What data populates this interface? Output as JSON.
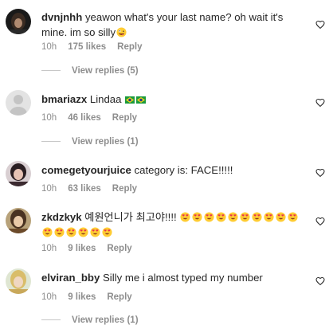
{
  "comments": [
    {
      "username": "dvnjnhh",
      "text": "yeawon what's your last name? oh wait it's mine. im so silly",
      "emoji": "zany-face",
      "time": "10h",
      "likes": "175 likes",
      "reply": "Reply",
      "view_replies": "View replies (5)"
    },
    {
      "username": "bmariazx",
      "text": "Lindaa",
      "emoji": "brazil-flags",
      "time": "10h",
      "likes": "46 likes",
      "reply": "Reply",
      "view_replies": "View replies (1)"
    },
    {
      "username": "comegetyourjuice",
      "text": "category is: FACE!!!!!",
      "time": "10h",
      "likes": "63 likes",
      "reply": "Reply"
    },
    {
      "username": "zkdzkyk",
      "text": "예원언니가 최고야!!!!",
      "emoji": "heart-eyes-face x16",
      "time": "10h",
      "likes": "9 likes",
      "reply": "Reply"
    },
    {
      "username": "elviran_bby",
      "text": "Silly me i almost typed my number",
      "time": "10h",
      "likes": "9 likes",
      "reply": "Reply",
      "view_replies": "View replies (1)"
    }
  ],
  "colors": {
    "primary_text": "#262626",
    "secondary_text": "#8e8e8e",
    "divider": "#c7c7c7",
    "background": "#ffffff"
  }
}
